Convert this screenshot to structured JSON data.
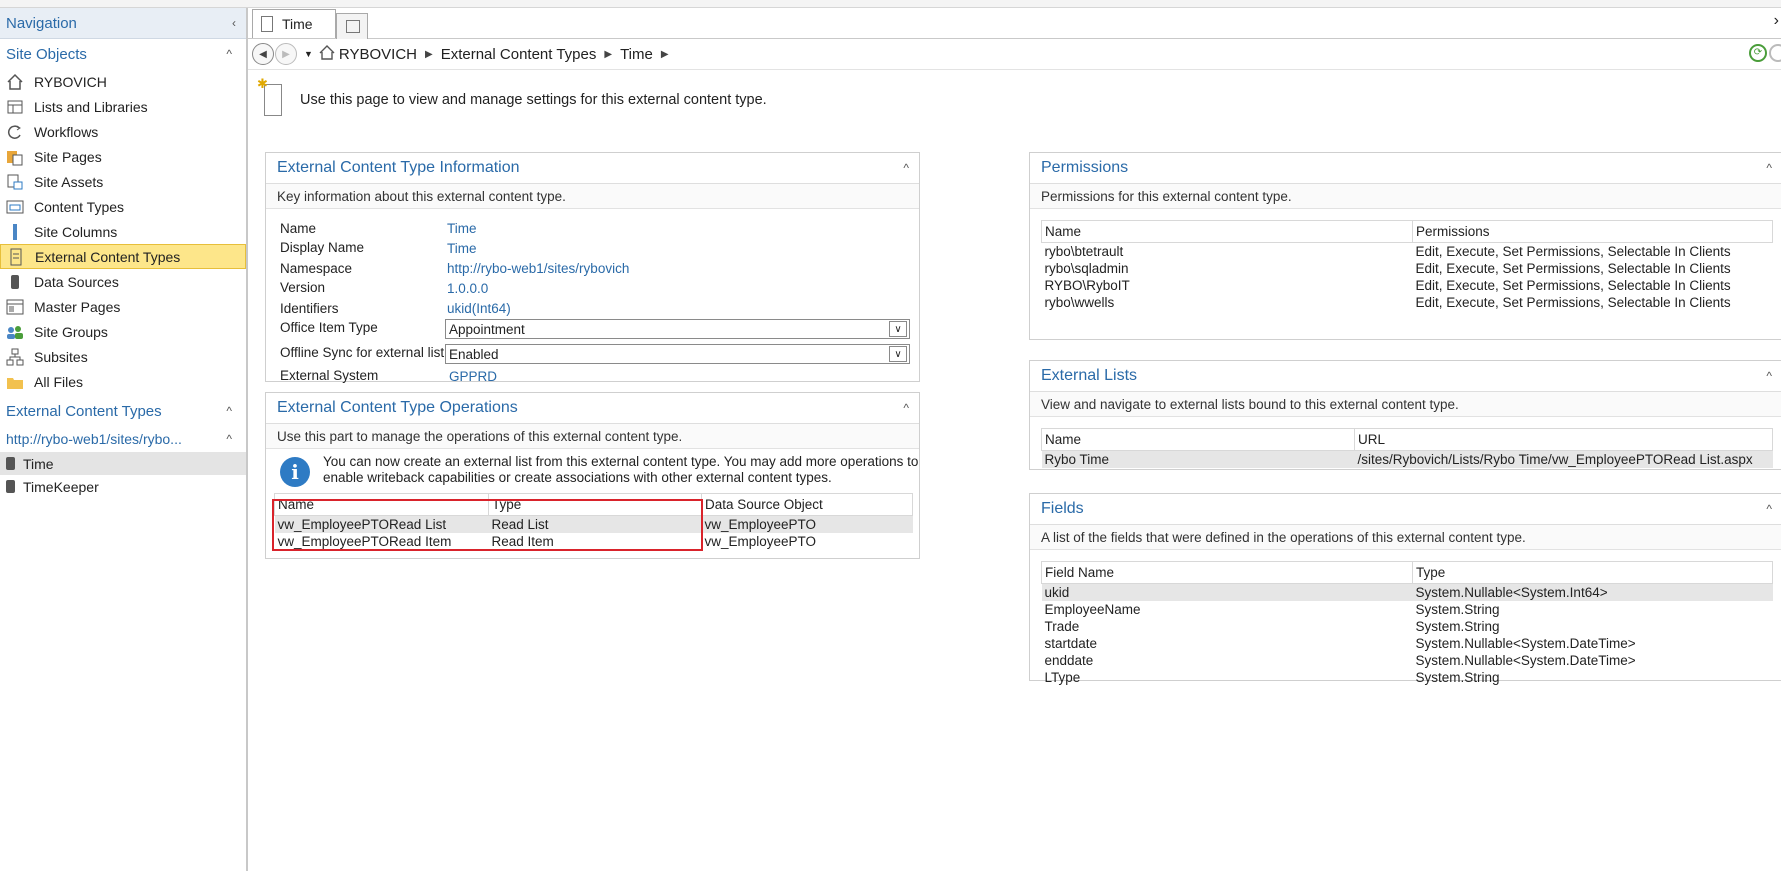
{
  "sidebar": {
    "nav_title": "Navigation",
    "site_objects_title": "Site Objects",
    "items": [
      {
        "label": "RYBOVICH",
        "icon": "home-icon"
      },
      {
        "label": "Lists and Libraries",
        "icon": "list-icon"
      },
      {
        "label": "Workflows",
        "icon": "workflow-icon"
      },
      {
        "label": "Site Pages",
        "icon": "site-pages-icon"
      },
      {
        "label": "Site Assets",
        "icon": "site-assets-icon"
      },
      {
        "label": "Content Types",
        "icon": "content-types-icon"
      },
      {
        "label": "Site Columns",
        "icon": "site-columns-icon"
      },
      {
        "label": "External Content Types",
        "icon": "external-content-types-icon"
      },
      {
        "label": "Data Sources",
        "icon": "data-sources-icon"
      },
      {
        "label": "Master Pages",
        "icon": "master-pages-icon"
      },
      {
        "label": "Site Groups",
        "icon": "site-groups-icon"
      },
      {
        "label": "Subsites",
        "icon": "subsites-icon"
      },
      {
        "label": "All Files",
        "icon": "folder-icon"
      }
    ],
    "ect_title": "External Content Types",
    "ect_site": "http://rybo-web1/sites/rybo...",
    "ect_items": [
      "Time",
      "TimeKeeper"
    ]
  },
  "tab": {
    "label": "Time"
  },
  "breadcrumb": {
    "items": [
      "RYBOVICH",
      "External Content Types",
      "Time"
    ]
  },
  "intro": "Use this page to view and manage settings for this external content type.",
  "info_panel": {
    "title": "External Content Type Information",
    "desc": "Key information about this external content type.",
    "name_label": "Name",
    "name_value": "Time",
    "display_label": "Display Name",
    "display_value": "Time",
    "namespace_label": "Namespace",
    "namespace_value": "http://rybo-web1/sites/rybovich",
    "version_label": "Version",
    "version_value": "1.0.0.0",
    "identifiers_label": "Identifiers",
    "identifiers_value": "ukid(Int64)",
    "office_label": "Office Item Type",
    "office_value": "Appointment",
    "offline_label": "Offline Sync for external list",
    "offline_value": "Enabled",
    "system_label": "External System",
    "system_value": "GPPRD"
  },
  "ops_panel": {
    "title": "External Content Type Operations",
    "desc": "Use this part to manage the operations of this external content type.",
    "info_line1": "You can now create an external list from this external content type. You may add more operations to",
    "info_line2": "enable writeback capabilities or create associations with other external content types.",
    "headers": [
      "Name",
      "Type",
      "Data Source Object"
    ],
    "rows": [
      [
        "vw_EmployeePTORead List",
        "Read List",
        "vw_EmployeePTO"
      ],
      [
        "vw_EmployeePTORead Item",
        "Read Item",
        "vw_EmployeePTO"
      ]
    ]
  },
  "perm_panel": {
    "title": "Permissions",
    "desc": "Permissions for this external content type.",
    "headers": [
      "Name",
      "Permissions"
    ],
    "rows": [
      [
        "rybo\\btetrault",
        "Edit, Execute, Set Permissions, Selectable In Clients"
      ],
      [
        "rybo\\sqladmin",
        "Edit, Execute, Set Permissions, Selectable In Clients"
      ],
      [
        "RYBO\\RyboIT",
        "Edit, Execute, Set Permissions, Selectable In Clients"
      ],
      [
        "rybo\\wwells",
        "Edit, Execute, Set Permissions, Selectable In Clients"
      ]
    ]
  },
  "lists_panel": {
    "title": "External Lists",
    "desc": "View and navigate to external lists bound to this external content type.",
    "headers": [
      "Name",
      "URL"
    ],
    "rows": [
      [
        "Rybo Time",
        "/sites/Rybovich/Lists/Rybo Time/vw_EmployeePTORead List.aspx"
      ]
    ]
  },
  "fields_panel": {
    "title": "Fields",
    "desc": "A list of the fields that were defined in the operations of this external content type.",
    "headers": [
      "Field Name",
      "Type"
    ],
    "rows": [
      [
        "ukid",
        "System.Nullable<System.Int64>"
      ],
      [
        "EmployeeName",
        "System.String"
      ],
      [
        "Trade",
        "System.String"
      ],
      [
        "startdate",
        "System.Nullable<System.DateTime>"
      ],
      [
        "enddate",
        "System.Nullable<System.DateTime>"
      ],
      [
        "LType",
        "System.String"
      ]
    ]
  },
  "colors": {
    "accent": "#2a6aa8",
    "selected": "#fde68a",
    "highlight_box": "#d9232b"
  }
}
